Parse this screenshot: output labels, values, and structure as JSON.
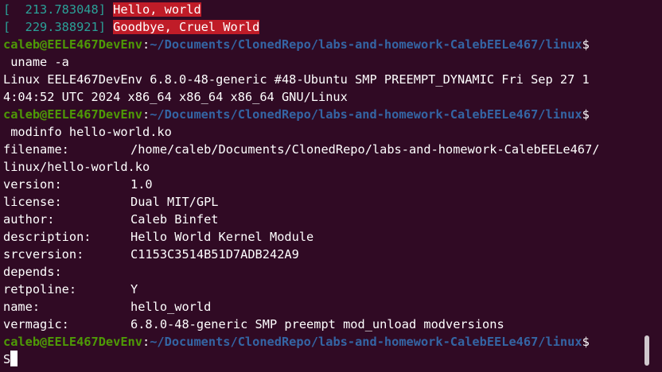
{
  "kernel_log": [
    {
      "ts": "[  213.783048]",
      "msg": "Hello, world"
    },
    {
      "ts": "[  229.388921]",
      "msg": "Goodbye, Cruel World"
    }
  ],
  "prompt": {
    "user_host": "caleb@EELE467DevEnv",
    "colon": ":",
    "path": "~/Documents/ClonedRepo/labs-and-homework-CalebEELe467/linux",
    "symbol": "$"
  },
  "commands": {
    "uname": " uname -a",
    "modinfo": " modinfo hello-world.ko",
    "current": "S"
  },
  "uname_output": [
    "Linux EELE467DevEnv 6.8.0-48-generic #48-Ubuntu SMP PREEMPT_DYNAMIC Fri Sep 27 1",
    "4:04:52 UTC 2024 x86_64 x86_64 x86_64 GNU/Linux"
  ],
  "modinfo": {
    "filename_key": "filename:",
    "filename_val": "/home/caleb/Documents/ClonedRepo/labs-and-homework-CalebEELe467/",
    "filename_wrap": "linux/hello-world.ko",
    "fields": [
      {
        "key": "version:",
        "value": "1.0"
      },
      {
        "key": "license:",
        "value": "Dual MIT/GPL"
      },
      {
        "key": "author:",
        "value": "Caleb Binfet"
      },
      {
        "key": "description:",
        "value": "Hello World Kernel Module"
      },
      {
        "key": "srcversion:",
        "value": "C1153C3514B51D7ADB242A9"
      },
      {
        "key": "depends:",
        "value": ""
      },
      {
        "key": "retpoline:",
        "value": "Y"
      },
      {
        "key": "name:",
        "value": "hello_world"
      },
      {
        "key": "vermagic:",
        "value": "6.8.0-48-generic SMP preempt mod_unload modversions"
      }
    ]
  },
  "colors": {
    "background": "#300a24",
    "prompt_user": "#4e9a06",
    "prompt_path": "#3465a4",
    "kernel_highlight": "#c01c28"
  }
}
